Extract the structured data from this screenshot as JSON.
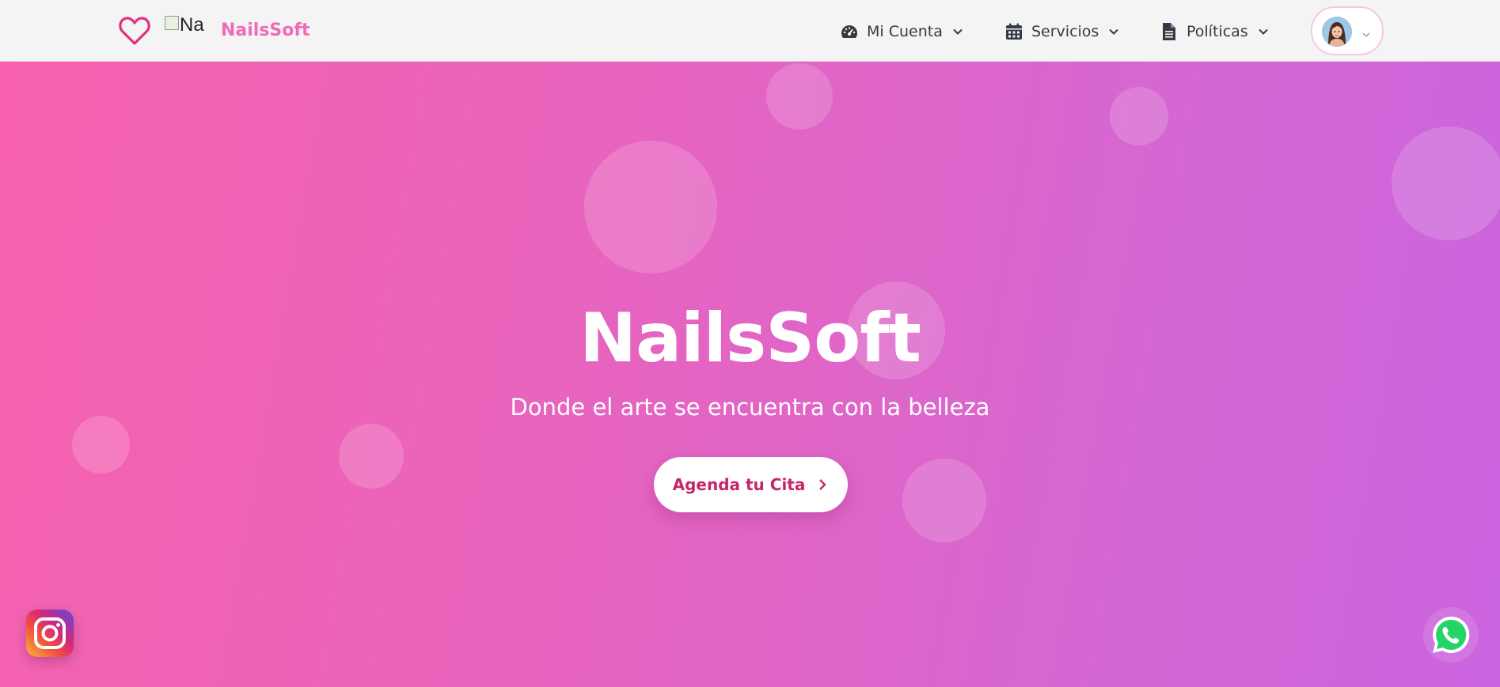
{
  "navbar": {
    "brand_logo_alt": "Na",
    "brand_name": "NailsSoft",
    "items": [
      {
        "label": "Mi Cuenta",
        "icon": "dashboard-icon"
      },
      {
        "label": "Servicios",
        "icon": "calendar-icon"
      },
      {
        "label": "Políticas",
        "icon": "document-icon"
      }
    ],
    "avatar_icon": "user-avatar-icon"
  },
  "hero": {
    "title": "NailsSoft",
    "subtitle": "Donde el arte se encuentra con la belleza",
    "cta_label": "Agenda tu Cita"
  },
  "social": {
    "instagram_icon": "instagram-icon",
    "whatsapp_icon": "whatsapp-icon"
  },
  "colors": {
    "brand_pink": "#f06ab8",
    "cta_text": "#c8246c",
    "hero_gradient_start": "#f862ae",
    "hero_gradient_end": "#ca64df",
    "whatsapp_green": "#25d366"
  }
}
